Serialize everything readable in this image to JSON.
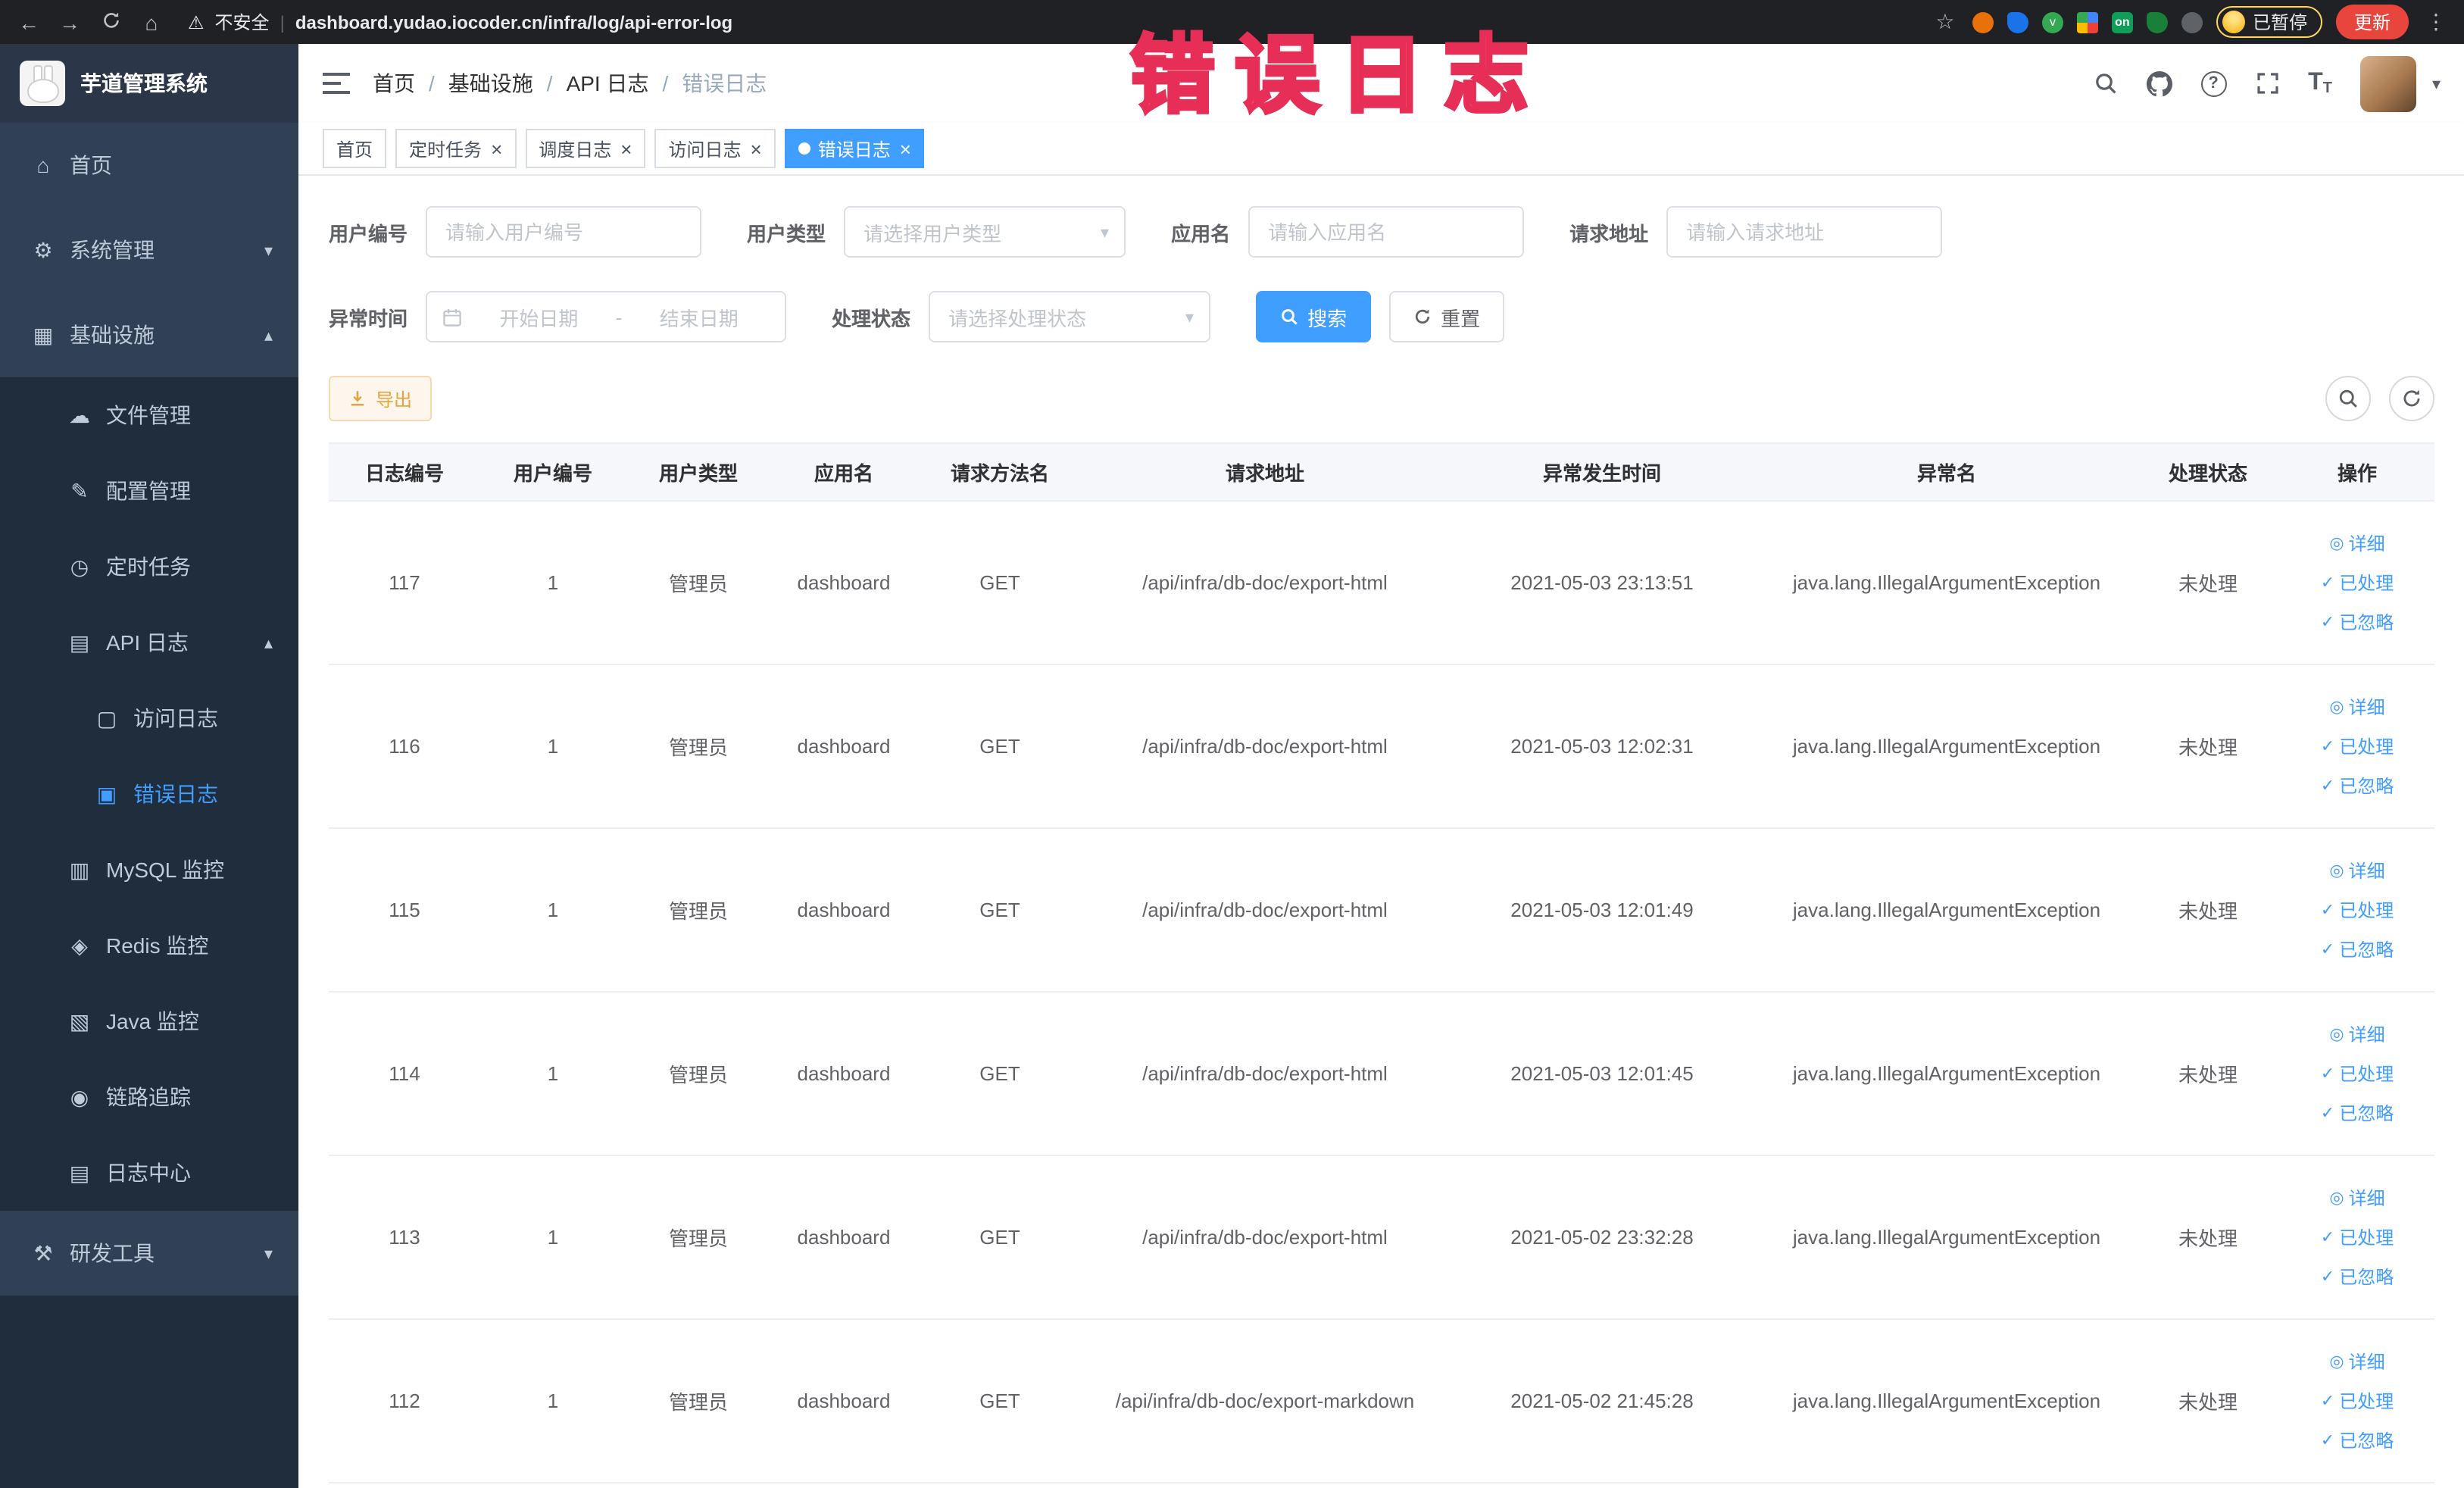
{
  "colors": {
    "accent": "#409eff",
    "sidebar_bg": "#1f2d3d",
    "sidebar_item_bg": "#304156",
    "warning": "#e6a23c",
    "danger_annotation": "#f5365c"
  },
  "browser": {
    "security_label": "不安全",
    "url": "dashboard.yudao.iocoder.cn/infra/log/api-error-log",
    "profile_badge": "已暂停",
    "update_button": "更新"
  },
  "overlay": {
    "annotation": "错误日志"
  },
  "sidebar": {
    "logo_title": "芋道管理系统",
    "menu": [
      {
        "key": "home",
        "label": "首页",
        "icon": "home-icon",
        "level": 1,
        "type": "item"
      },
      {
        "key": "system",
        "label": "系统管理",
        "icon": "gear-icon",
        "level": 1,
        "type": "group",
        "state": "collapsed"
      },
      {
        "key": "infra",
        "label": "基础设施",
        "icon": "infra-icon",
        "level": 1,
        "type": "group",
        "state": "expanded"
      },
      {
        "key": "file",
        "label": "文件管理",
        "icon": "file-icon",
        "level": 2,
        "type": "item"
      },
      {
        "key": "config",
        "label": "配置管理",
        "icon": "config-icon",
        "level": 2,
        "type": "item"
      },
      {
        "key": "job",
        "label": "定时任务",
        "icon": "timer-icon",
        "level": 2,
        "type": "item"
      },
      {
        "key": "api-log",
        "label": "API 日志",
        "icon": "api-log-icon",
        "level": 2,
        "type": "group",
        "state": "expanded"
      },
      {
        "key": "access-log",
        "label": "访问日志",
        "icon": "access-log-icon",
        "level": 3,
        "type": "item"
      },
      {
        "key": "error-log",
        "label": "错误日志",
        "icon": "error-log-icon",
        "level": 3,
        "type": "item",
        "active": true
      },
      {
        "key": "mysql",
        "label": "MySQL 监控",
        "icon": "mysql-icon",
        "level": 2,
        "type": "item"
      },
      {
        "key": "redis",
        "label": "Redis 监控",
        "icon": "redis-icon",
        "level": 2,
        "type": "item"
      },
      {
        "key": "java",
        "label": "Java 监控",
        "icon": "java-icon",
        "level": 2,
        "type": "item"
      },
      {
        "key": "trace",
        "label": "链路追踪",
        "icon": "trace-icon",
        "level": 2,
        "type": "item"
      },
      {
        "key": "log-center",
        "label": "日志中心",
        "icon": "log-center-icon",
        "level": 2,
        "type": "item"
      },
      {
        "key": "dev-tools",
        "label": "研发工具",
        "icon": "tools-icon",
        "level": 1,
        "type": "group",
        "state": "collapsed"
      }
    ]
  },
  "topbar": {
    "breadcrumb": [
      "首页",
      "基础设施",
      "API 日志",
      "错误日志"
    ]
  },
  "tabs": [
    {
      "key": "home",
      "label": "首页",
      "closable": false,
      "active": false
    },
    {
      "key": "job",
      "label": "定时任务",
      "closable": true,
      "active": false
    },
    {
      "key": "job-log",
      "label": "调度日志",
      "closable": true,
      "active": false
    },
    {
      "key": "access-log",
      "label": "访问日志",
      "closable": true,
      "active": false
    },
    {
      "key": "error-log",
      "label": "错误日志",
      "closable": true,
      "active": true
    }
  ],
  "filters": {
    "user_id": {
      "label": "用户编号",
      "placeholder": "请输入用户编号"
    },
    "user_type": {
      "label": "用户类型",
      "placeholder": "请选择用户类型"
    },
    "app_name": {
      "label": "应用名",
      "placeholder": "请输入应用名"
    },
    "request_url": {
      "label": "请求地址",
      "placeholder": "请输入请求地址"
    },
    "exception_time": {
      "label": "异常时间",
      "start_placeholder": "开始日期",
      "separator": "-",
      "end_placeholder": "结束日期"
    },
    "process_status": {
      "label": "处理状态",
      "placeholder": "请选择处理状态"
    },
    "search_button": "搜索",
    "reset_button": "重置"
  },
  "toolbar": {
    "export_button": "导出"
  },
  "table": {
    "columns": [
      "日志编号",
      "用户编号",
      "用户类型",
      "应用名",
      "请求方法名",
      "请求地址",
      "异常发生时间",
      "异常名",
      "处理状态",
      "操作"
    ],
    "action_labels": [
      "详细",
      "已处理",
      "已忽略"
    ],
    "rows": [
      {
        "log_id": "117",
        "user_id": "1",
        "user_type": "管理员",
        "app_name": "dashboard",
        "method": "GET",
        "url": "/api/infra/db-doc/export-html",
        "time": "2021-05-03 23:13:51",
        "exception": "java.lang.IllegalArgumentException",
        "status": "未处理"
      },
      {
        "log_id": "116",
        "user_id": "1",
        "user_type": "管理员",
        "app_name": "dashboard",
        "method": "GET",
        "url": "/api/infra/db-doc/export-html",
        "time": "2021-05-03 12:02:31",
        "exception": "java.lang.IllegalArgumentException",
        "status": "未处理"
      },
      {
        "log_id": "115",
        "user_id": "1",
        "user_type": "管理员",
        "app_name": "dashboard",
        "method": "GET",
        "url": "/api/infra/db-doc/export-html",
        "time": "2021-05-03 12:01:49",
        "exception": "java.lang.IllegalArgumentException",
        "status": "未处理"
      },
      {
        "log_id": "114",
        "user_id": "1",
        "user_type": "管理员",
        "app_name": "dashboard",
        "method": "GET",
        "url": "/api/infra/db-doc/export-html",
        "time": "2021-05-03 12:01:45",
        "exception": "java.lang.IllegalArgumentException",
        "status": "未处理"
      },
      {
        "log_id": "113",
        "user_id": "1",
        "user_type": "管理员",
        "app_name": "dashboard",
        "method": "GET",
        "url": "/api/infra/db-doc/export-html",
        "time": "2021-05-02 23:32:28",
        "exception": "java.lang.IllegalArgumentException",
        "status": "未处理"
      },
      {
        "log_id": "112",
        "user_id": "1",
        "user_type": "管理员",
        "app_name": "dashboard",
        "method": "GET",
        "url": "/api/infra/db-doc/export-markdown",
        "time": "2021-05-02 21:45:28",
        "exception": "java.lang.IllegalArgumentException",
        "status": "未处理"
      }
    ]
  }
}
